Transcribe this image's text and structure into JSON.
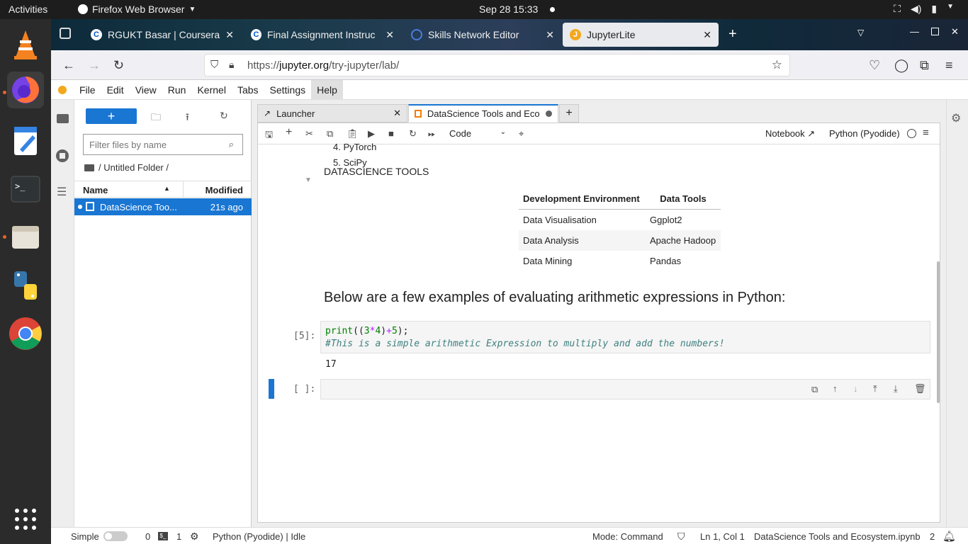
{
  "system": {
    "activities": "Activities",
    "app_name": "Firefox Web Browser",
    "clock": "Sep 28  15:33"
  },
  "browser": {
    "tabs": [
      {
        "label": "RGUKT Basar | Coursera",
        "icon": "coursera-icon"
      },
      {
        "label": "Final Assignment Instruc",
        "icon": "coursera-icon"
      },
      {
        "label": "Skills Network Editor",
        "icon": "globe-icon"
      },
      {
        "label": "JupyterLite",
        "icon": "jupyter-icon"
      }
    ],
    "url_prefix": "https://",
    "url_host": "jupyter.org",
    "url_path": "/try-jupyter/lab/"
  },
  "jupyter": {
    "menu": [
      "File",
      "Edit",
      "Run",
      "Kernel",
      "Tabs",
      "Settings",
      "Help"
    ],
    "filebrowser": {
      "filter_placeholder": "Filter files by name",
      "breadcrumb": "/ Untitled Folder /",
      "col_name": "Name",
      "col_modified": "Modified",
      "file_name": "DataScience Too...",
      "file_modified": "21s ago"
    },
    "tabs": [
      "Launcher",
      "DataScience Tools and Ecosy"
    ],
    "cell_type": "Code",
    "notebook_label": "Notebook",
    "kernel": "Python (Pyodide)",
    "list_items": [
      "4. PyTorch",
      "5. SciPy"
    ],
    "section_title": "DATASCIENCE TOOLS",
    "table": {
      "headers": [
        "Development Environment",
        "Data Tools"
      ],
      "rows": [
        [
          "Data Visualisation",
          "Ggplot2"
        ],
        [
          "Data Analysis",
          "Apache Hadoop"
        ],
        [
          "Data Mining",
          "Pandas"
        ]
      ]
    },
    "heading": "Below are a few examples of evaluating arithmetic expressions in Python:",
    "cell1_prompt": "[5]:",
    "cell1_line1": "print((3*4)+5);",
    "cell1_line2": "#This is a simple arithmetic Expression to multiply and add the numbers!",
    "cell1_output": "17",
    "cell2_prompt": "[ ]:"
  },
  "status": {
    "mode_simple": "Simple",
    "terminals": "0",
    "kernels": "1",
    "kernel_status": "Python (Pyodide) | Idle",
    "mode": "Mode: Command",
    "position": "Ln 1, Col 1",
    "filename": "DataScience Tools and Ecosystem.ipynb",
    "notifications": "2"
  }
}
